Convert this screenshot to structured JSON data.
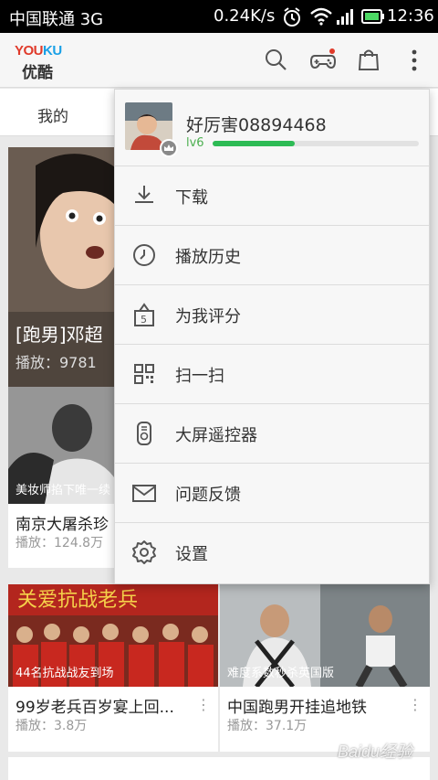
{
  "status_bar": {
    "carrier": "中国联通 3G",
    "speed": "0.24K/s",
    "time": "12:36"
  },
  "app": {
    "logo_text": "YOUKU",
    "logo_cn": "优酷"
  },
  "tabs": [
    {
      "label": "我的"
    }
  ],
  "feed": {
    "featured": {
      "caption": "[跑男]邓超",
      "plays": "播放：9781"
    },
    "card_left": {
      "overlay": "美妆师掐下唯一续",
      "title": "南京大屠杀珍",
      "plays": "播放：124.8万"
    },
    "cards": [
      {
        "overlay": "44名抗战战友到场",
        "title": "99岁老兵百岁宴上回...",
        "plays": "播放：3.8万",
        "more": "⋮"
      },
      {
        "overlay": "难度系数秒杀英国版",
        "title": "中国跑男开挂追地铁",
        "plays": "播放：37.1万",
        "more": "⋮"
      }
    ]
  },
  "menu": {
    "username": "好厉害08894468",
    "level": "lv6",
    "level_progress": 0.4,
    "items": [
      {
        "label": "下载",
        "icon": "download-icon"
      },
      {
        "label": "播放历史",
        "icon": "clock-icon"
      },
      {
        "label": "为我评分",
        "icon": "rate-bag-icon"
      },
      {
        "label": "扫一扫",
        "icon": "qr-scan-icon"
      },
      {
        "label": "大屏遥控器",
        "icon": "remote-icon"
      },
      {
        "label": "问题反馈",
        "icon": "mail-icon"
      },
      {
        "label": "设置",
        "icon": "gear-icon"
      }
    ]
  },
  "watermark": "Baidu经验",
  "colors": {
    "accent_green": "#2dbb55",
    "youku_red": "#e03a2a",
    "youku_blue": "#1aa0e6"
  }
}
